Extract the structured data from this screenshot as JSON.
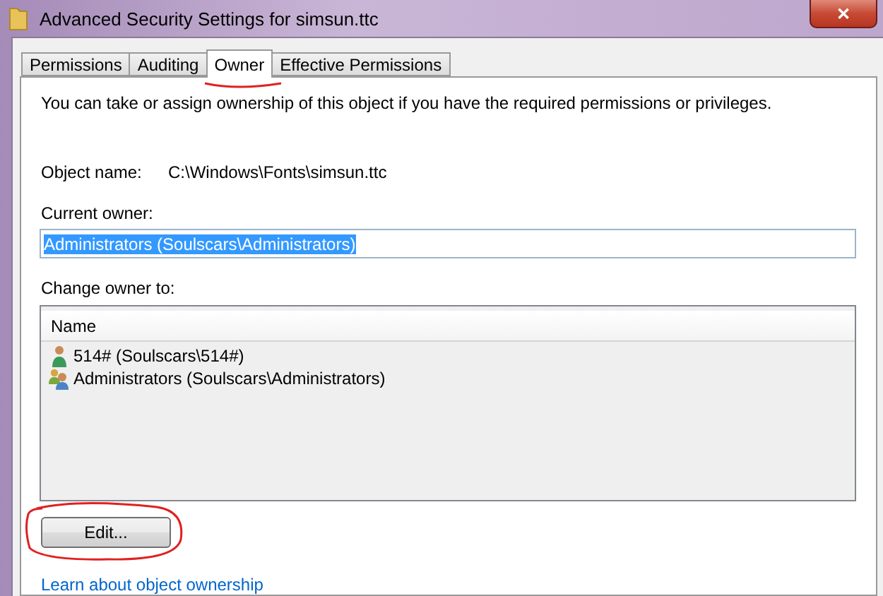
{
  "window": {
    "title": "Advanced Security Settings for simsun.ttc",
    "close": "✕"
  },
  "tabs": [
    {
      "label": "Permissions",
      "selected": false
    },
    {
      "label": "Auditing",
      "selected": false
    },
    {
      "label": "Owner",
      "selected": true,
      "annotated": true
    },
    {
      "label": "Effective Permissions",
      "selected": false
    }
  ],
  "intro": "You can take or assign ownership of this object if you have the required permissions or privileges.",
  "object_name": {
    "label": "Object name:",
    "value": "C:\\Windows\\Fonts\\simsun.ttc"
  },
  "current_owner": {
    "label": "Current owner:",
    "value": "Administrators (Soulscars\\Administrators)",
    "selected": true
  },
  "change_owner": {
    "label": "Change owner to:",
    "column": "Name",
    "rows": [
      {
        "kind": "user",
        "name": "514# (Soulscars\\514#)"
      },
      {
        "kind": "group",
        "name": "Administrators (Soulscars\\Administrators)"
      }
    ]
  },
  "edit_button": {
    "label": "Edit...",
    "annotated": true
  },
  "link": "Learn about object ownership"
}
